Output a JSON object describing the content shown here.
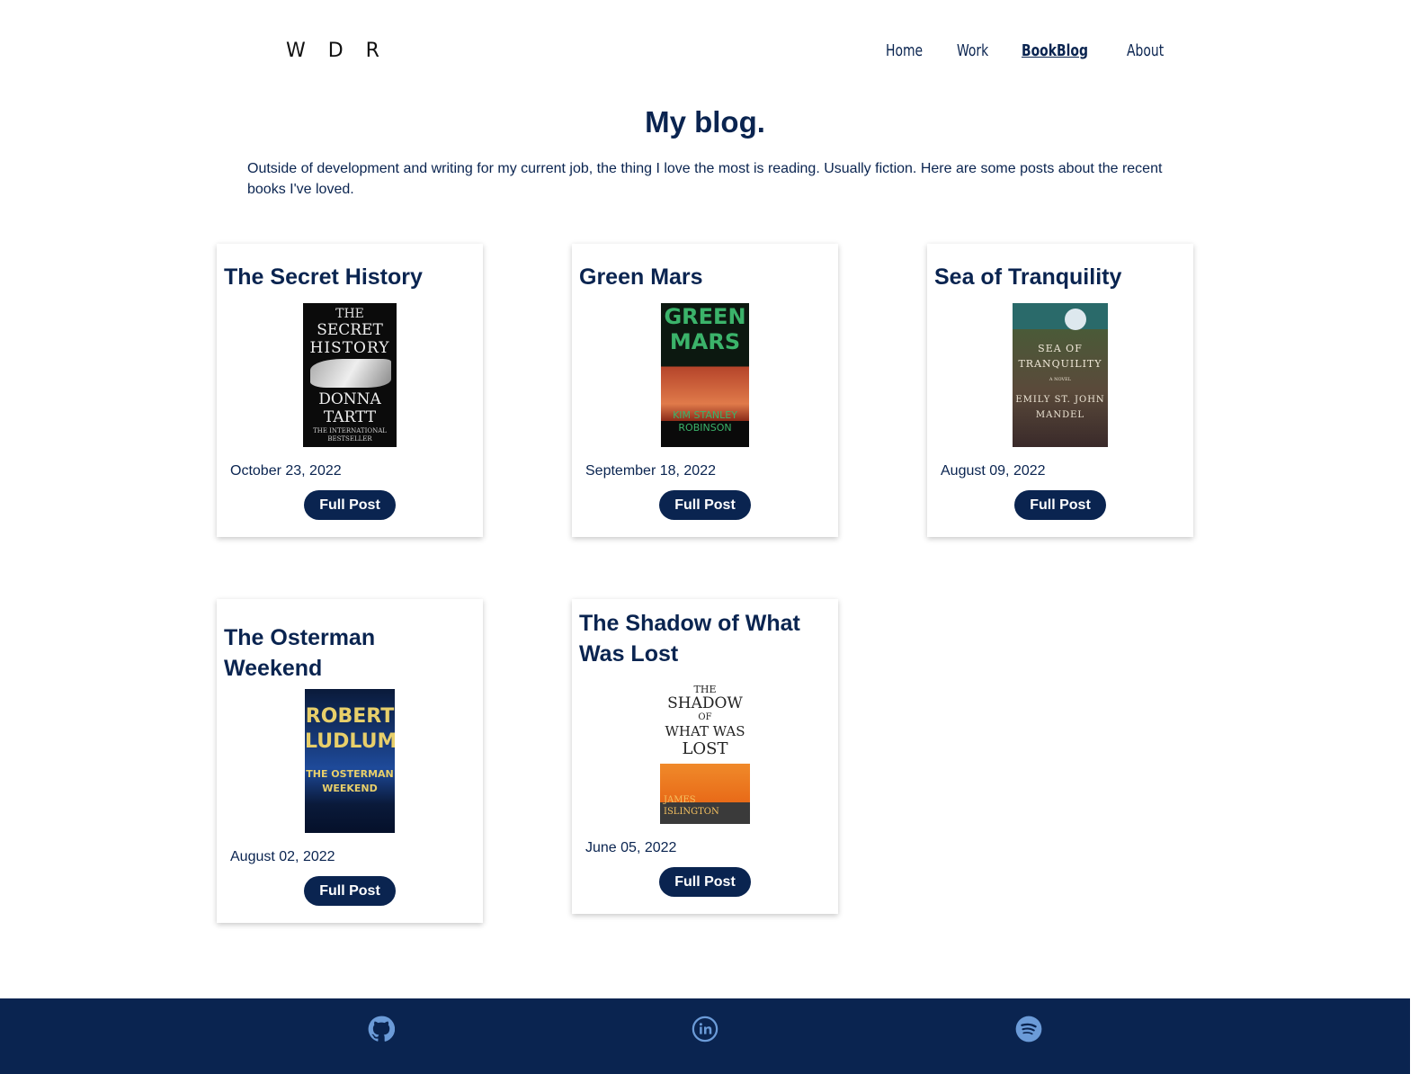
{
  "header": {
    "logo": "W D R",
    "nav": [
      {
        "label": "Home"
      },
      {
        "label": "Work"
      },
      {
        "label": "BookBlog"
      },
      {
        "label": "About"
      }
    ]
  },
  "main": {
    "title": "My blog.",
    "intro": "Outside of development and writing for my current job, the thing I love the most is reading. Usually fiction. Here are some posts about the recent books I've loved."
  },
  "posts": [
    {
      "title": "The Secret History",
      "date": "October 23, 2022",
      "button": "Full Post",
      "cover": {
        "top": "THE",
        "mid": "SECRET",
        "line3": "HISTORY",
        "author1": "DONNA",
        "author2": "TARTT",
        "tag": "THE INTERNATIONAL BESTSELLER"
      }
    },
    {
      "title": "Green Mars",
      "date": "September 18, 2022",
      "button": "Full Post",
      "cover": {
        "line1": "GREEN",
        "line2": "MARS",
        "author1": "KIM STANLEY",
        "author2": "ROBINSON"
      }
    },
    {
      "title": "Sea of Tranquility",
      "date": "August 09, 2022",
      "button": "Full Post",
      "cover": {
        "line1": "SEA OF",
        "line2": "TRANQUILITY",
        "tag": "A NOVEL",
        "author1": "EMILY ST. JOHN",
        "author2": "MANDEL"
      }
    },
    {
      "title": "The Osterman Weekend",
      "date": "August 02, 2022",
      "button": "Full Post",
      "cover": {
        "author1": "ROBERT",
        "author2": "LUDLUM",
        "line1": "THE OSTERMAN",
        "line2": "WEEKEND"
      }
    },
    {
      "title": "The Shadow of What Was Lost",
      "date": "June 05, 2022",
      "button": "Full Post",
      "cover": {
        "line1": "THE",
        "line2": "SHADOW",
        "line3": "OF",
        "line4": "WHAT WAS",
        "line5": "LOST",
        "author1": "JAMES",
        "author2": "ISLINGTON"
      }
    }
  ],
  "footer": {
    "icons": [
      "github-icon",
      "linkedin-icon",
      "spotify-icon"
    ]
  },
  "colors": {
    "navy": "#0a2450",
    "icon": "#6b9bd8"
  }
}
